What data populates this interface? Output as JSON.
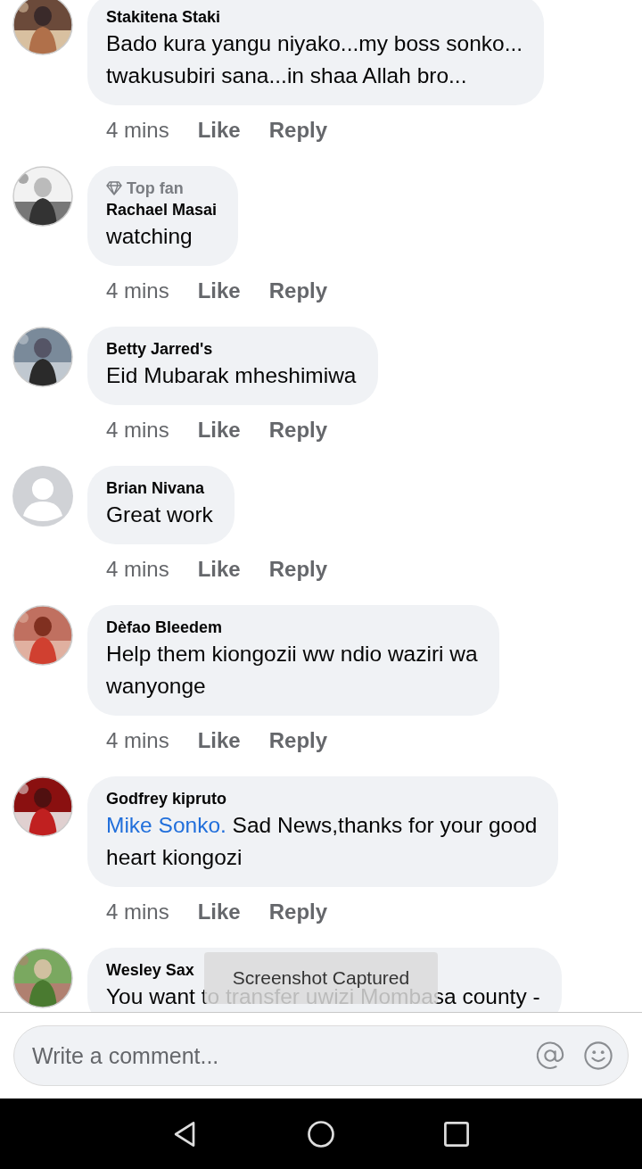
{
  "comments": [
    {
      "name": "Stakitena Staki",
      "text": "Bado kura yangu niyako...my boss sonko...\ntwakusubiri sana...in shaa Allah bro...",
      "time": "4 mins",
      "like": "Like",
      "reply": "Reply"
    },
    {
      "badge": "Top fan",
      "name": "Rachael Masai",
      "text": "watching",
      "time": "4 mins",
      "like": "Like",
      "reply": "Reply"
    },
    {
      "name": "Betty Jarred's",
      "text": "Eid Mubarak mheshimiwa",
      "time": "4 mins",
      "like": "Like",
      "reply": "Reply"
    },
    {
      "avatar": {
        "kind": "default"
      },
      "name": "Brian Nivana",
      "text": "Great work",
      "time": "4 mins",
      "like": "Like",
      "reply": "Reply"
    },
    {
      "name": "Dèfao Bleedem",
      "text": "Help them kiongozii ww ndio waziri wa\nwanyonge",
      "time": "4 mins",
      "like": "Like",
      "reply": "Reply"
    },
    {
      "name": "Godfrey kipruto",
      "mention": "Mike Sonko.",
      "text": "Sad News,thanks for your good\nheart kiongozi",
      "time": "4 mins",
      "like": "Like",
      "reply": "Reply"
    },
    {
      "name": "Wesley Sax",
      "text": "You want to transfer uwizi Mombasa county -"
    }
  ],
  "toast": "Screenshot Captured",
  "composer": {
    "placeholder": "Write a comment..."
  }
}
